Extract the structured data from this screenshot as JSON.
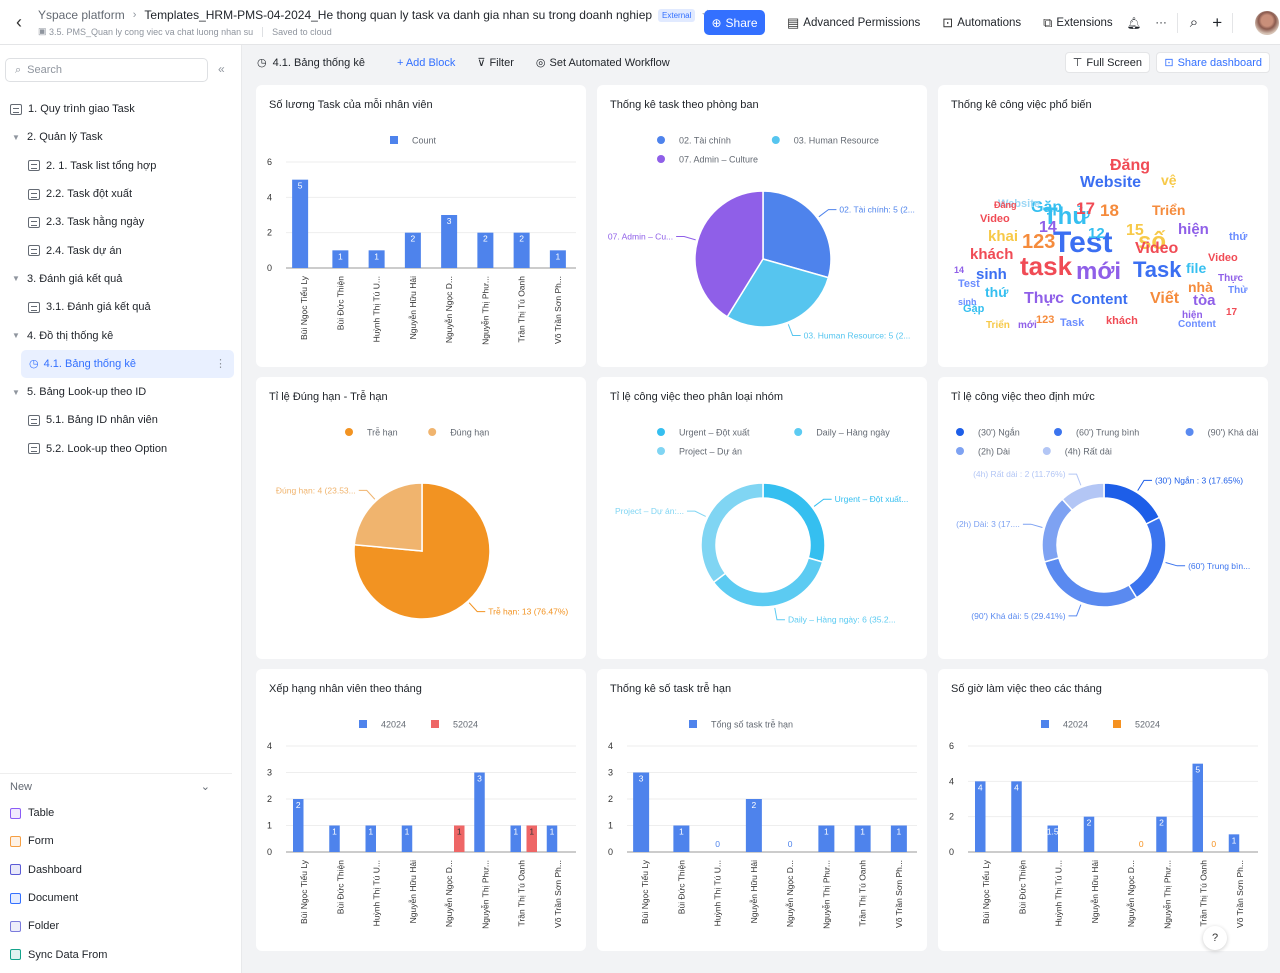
{
  "topbar": {
    "back_icon": "chevron-left-icon",
    "breadcrumb_root": "Yspace platform",
    "doc_title": "Templates_HRM-PMS-04-2024_He thong quan ly task va danh gia nhan su trong doanh nghiep",
    "badge": "External",
    "subtitle_folder": "3.5. PMS_Quan ly cong viec va chat luong nhan su",
    "save_status": "Saved to cloud",
    "share_label": "Share",
    "advanced_permissions_label": "Advanced Permissions",
    "automations_label": "Automations",
    "extensions_label": "Extensions"
  },
  "sidebar": {
    "search_placeholder": "Search",
    "items": [
      {
        "label": "1. Quy trình giao Task",
        "level": 0,
        "type": "doc"
      },
      {
        "label": "2. Quản lý Task",
        "level": 0,
        "type": "folder"
      },
      {
        "label": "2. 1. Task list tổng hợp",
        "level": 1,
        "type": "table"
      },
      {
        "label": "2.2. Task đột xuất",
        "level": 1,
        "type": "table"
      },
      {
        "label": "2.3. Task hằng ngày",
        "level": 1,
        "type": "table"
      },
      {
        "label": "2.4. Task dự án",
        "level": 1,
        "type": "table"
      },
      {
        "label": "3. Đánh giá kết quả",
        "level": 0,
        "type": "folder"
      },
      {
        "label": "3.1. Đánh giá kết quả",
        "level": 1,
        "type": "table"
      },
      {
        "label": "4. Đồ thị thống kê",
        "level": 0,
        "type": "folder"
      },
      {
        "label": "4.1. Bảng thống kê",
        "level": 1,
        "type": "dashboard",
        "active": true
      },
      {
        "label": "5. Bảng Look-up theo ID",
        "level": 0,
        "type": "folder"
      },
      {
        "label": "5.1. Bảng ID nhân viên",
        "level": 1,
        "type": "table"
      },
      {
        "label": "5.2. Look-up theo Option",
        "level": 1,
        "type": "table"
      }
    ],
    "new_label": "New",
    "new_items": [
      {
        "label": "Table",
        "color": "#8b5cf6"
      },
      {
        "label": "Form",
        "color": "#f59e42"
      },
      {
        "label": "Dashboard",
        "color": "#5b5bd6"
      },
      {
        "label": "Document",
        "color": "#3370ff"
      },
      {
        "label": "Folder",
        "color": "#7b7bdc"
      },
      {
        "label": "Sync Data From",
        "color": "#14a38b"
      }
    ]
  },
  "dashboard": {
    "title": "4.1. Bảng thống kê",
    "add_block": "+ Add Block",
    "filter": "Filter",
    "workflow": "Set Automated Workflow",
    "full_screen": "Full Screen",
    "share_dashboard": "Share dashboard"
  },
  "colors": {
    "blue": "#4e83ec",
    "red": "#ee6666",
    "orange": "#f59120",
    "accent": "#3370ff"
  },
  "chart_data": [
    {
      "id": "c1",
      "type": "bar",
      "title": "Số lương Task của mỗi nhân viên",
      "categories": [
        "Bùi Ngọc Tiểu Ly",
        "Bùi Đức Thiện",
        "Huỳnh Thị Tú U...",
        "Nguyễn Hữu Hải",
        "Nguyễn Ngọc D...",
        "Nguyễn Thị Phư...",
        "Trần Thị Tú Oanh",
        "Võ Trần Sơn Ph..."
      ],
      "series": [
        {
          "name": "Count",
          "color": "#4e83ec",
          "values": [
            5,
            1,
            1,
            2,
            3,
            2,
            2,
            1
          ]
        }
      ],
      "yticks": [
        0,
        2,
        4,
        6
      ],
      "ylim": [
        0,
        6
      ],
      "legend": "top"
    },
    {
      "id": "c2",
      "type": "pie",
      "title": "Thống kê task theo phòng ban",
      "slices": [
        {
          "name": "02. Tài chính",
          "value": 5,
          "color": "#4e83ec",
          "label": "02. Tài chính: 5 (2..."
        },
        {
          "name": "03. Human Resource",
          "value": 5,
          "color": "#56c5ef",
          "label": "03. Human Resource: 5 (2..."
        },
        {
          "name": "07. Admin – Culture",
          "value": 7,
          "color": "#8f5fe8",
          "label": "07. Admin – Cu..."
        }
      ],
      "legend": "top"
    },
    {
      "id": "c3",
      "type": "wordcloud",
      "title": "Thống kê công việc phổ biến",
      "words": [
        "Test",
        "Thử",
        "task",
        "mới",
        "Task",
        "số",
        "123",
        "Website",
        "Content",
        "Thực",
        "Đăng",
        "Video",
        "khách",
        "sinh",
        "Viết",
        "Gặp",
        "Triển",
        "hiện",
        "file",
        "nhà",
        "tòa",
        "vệ",
        "khai",
        "thứ",
        "17",
        "18",
        "14",
        "15",
        "12"
      ]
    },
    {
      "id": "c4",
      "type": "pie",
      "title": "Tỉ lệ Đúng hạn - Trễ hạn",
      "slices": [
        {
          "name": "Trễ hạn",
          "value": 13,
          "color": "#f29322",
          "label": "Trễ hạn: 13 (76.47%)"
        },
        {
          "name": "Đúng hạn",
          "value": 4,
          "color": "#f0b46e",
          "label": "Đúng hạn: 4 (23.53..."
        }
      ],
      "legend": "top"
    },
    {
      "id": "c5",
      "type": "donut",
      "title": "Tỉ lệ công việc theo phân loại nhóm",
      "slices": [
        {
          "name": "Urgent – Đột xuất",
          "value": 5,
          "color": "#35bff0",
          "label": "Urgent – Đột xuất..."
        },
        {
          "name": "Daily – Hàng ngày",
          "value": 6,
          "color": "#5ccbf2",
          "label": "Daily – Hàng ngày: 6 (35.2..."
        },
        {
          "name": "Project – Dự án",
          "value": 6,
          "color": "#80d5f3",
          "label": "Project – Dự án:..."
        }
      ],
      "legend": "top"
    },
    {
      "id": "c6",
      "type": "donut",
      "title": "Tỉ lệ công việc theo định mức",
      "slices": [
        {
          "name": "(30') Ngắn",
          "value": 3,
          "color": "#1d5ee8",
          "label": "(30') Ngắn : 3 (17.65%)"
        },
        {
          "name": "(60') Trung bình",
          "value": 4,
          "color": "#3b74ee",
          "label": "(60') Trung bìn..."
        },
        {
          "name": "(90') Khá dài",
          "value": 5,
          "color": "#5a8af0",
          "label": "(90') Khá dài: 5 (29.41%)"
        },
        {
          "name": "(2h) Dài",
          "value": 3,
          "color": "#7ea2f2",
          "label": "(2h) Dài: 3 (17...."
        },
        {
          "name": "(4h) Rất dài",
          "value": 2,
          "color": "#b3c6f5",
          "label": "(4h) Rất dài : 2 (11.76%)"
        }
      ],
      "legend": "top"
    },
    {
      "id": "c7",
      "type": "bar",
      "title": "Xếp hạng nhân viên theo tháng",
      "categories": [
        "Bùi Ngọc Tiểu Ly",
        "Bùi Đức Thiện",
        "Huỳnh Thị Tú U...",
        "Nguyễn Hữu Hải",
        "Nguyễn Ngọc D...",
        "Nguyễn Thị Phư...",
        "Trần Thị Tú Oanh",
        "Võ Trần Sơn Ph..."
      ],
      "series": [
        {
          "name": "42024",
          "color": "#4e83ec",
          "values": [
            2,
            1,
            1,
            1,
            null,
            3,
            1,
            1
          ]
        },
        {
          "name": "52024",
          "color": "#ee6666",
          "values": [
            null,
            null,
            null,
            null,
            1,
            null,
            1,
            null
          ]
        }
      ],
      "yticks": [
        0,
        1,
        2,
        3,
        4
      ],
      "ylim": [
        0,
        4
      ],
      "legend": "top"
    },
    {
      "id": "c8",
      "type": "bar",
      "title": "Thống kê số task trễ hạn",
      "categories": [
        "Bùi Ngọc Tiểu Ly",
        "Bùi Đức Thiện",
        "Huỳnh Thị Tú U...",
        "Nguyễn Hữu Hải",
        "Nguyễn Ngọc D...",
        "Nguyễn Thị Phư...",
        "Trần Thị Tú Oanh",
        "Võ Trần Sơn Ph..."
      ],
      "series": [
        {
          "name": "Tổng số task trễ hạn",
          "color": "#4e83ec",
          "values": [
            3,
            1,
            0,
            2,
            0,
            1,
            1,
            1
          ]
        }
      ],
      "yticks": [
        0,
        1,
        2,
        3,
        4
      ],
      "ylim": [
        0,
        4
      ],
      "legend": "top"
    },
    {
      "id": "c9",
      "type": "bar",
      "title": "Số giờ làm việc theo các tháng",
      "categories": [
        "Bùi Ngọc Tiểu Ly",
        "Bùi Đức Thiện",
        "Huỳnh Thị Tú U...",
        "Nguyễn Hữu Hải",
        "Nguyễn Ngọc D...",
        "Nguyễn Thị Phư...",
        "Trần Thị Tú Oanh",
        "Võ Trần Sơn Ph..."
      ],
      "series": [
        {
          "name": "42024",
          "color": "#4e83ec",
          "values": [
            4,
            4,
            1.5,
            2,
            null,
            2,
            5,
            1
          ]
        },
        {
          "name": "52024",
          "color": "#f59120",
          "values": [
            null,
            null,
            null,
            null,
            0,
            null,
            0,
            null
          ]
        }
      ],
      "yticks": [
        0,
        2,
        4,
        6
      ],
      "ylim": [
        0,
        6
      ],
      "legend": "top"
    }
  ]
}
